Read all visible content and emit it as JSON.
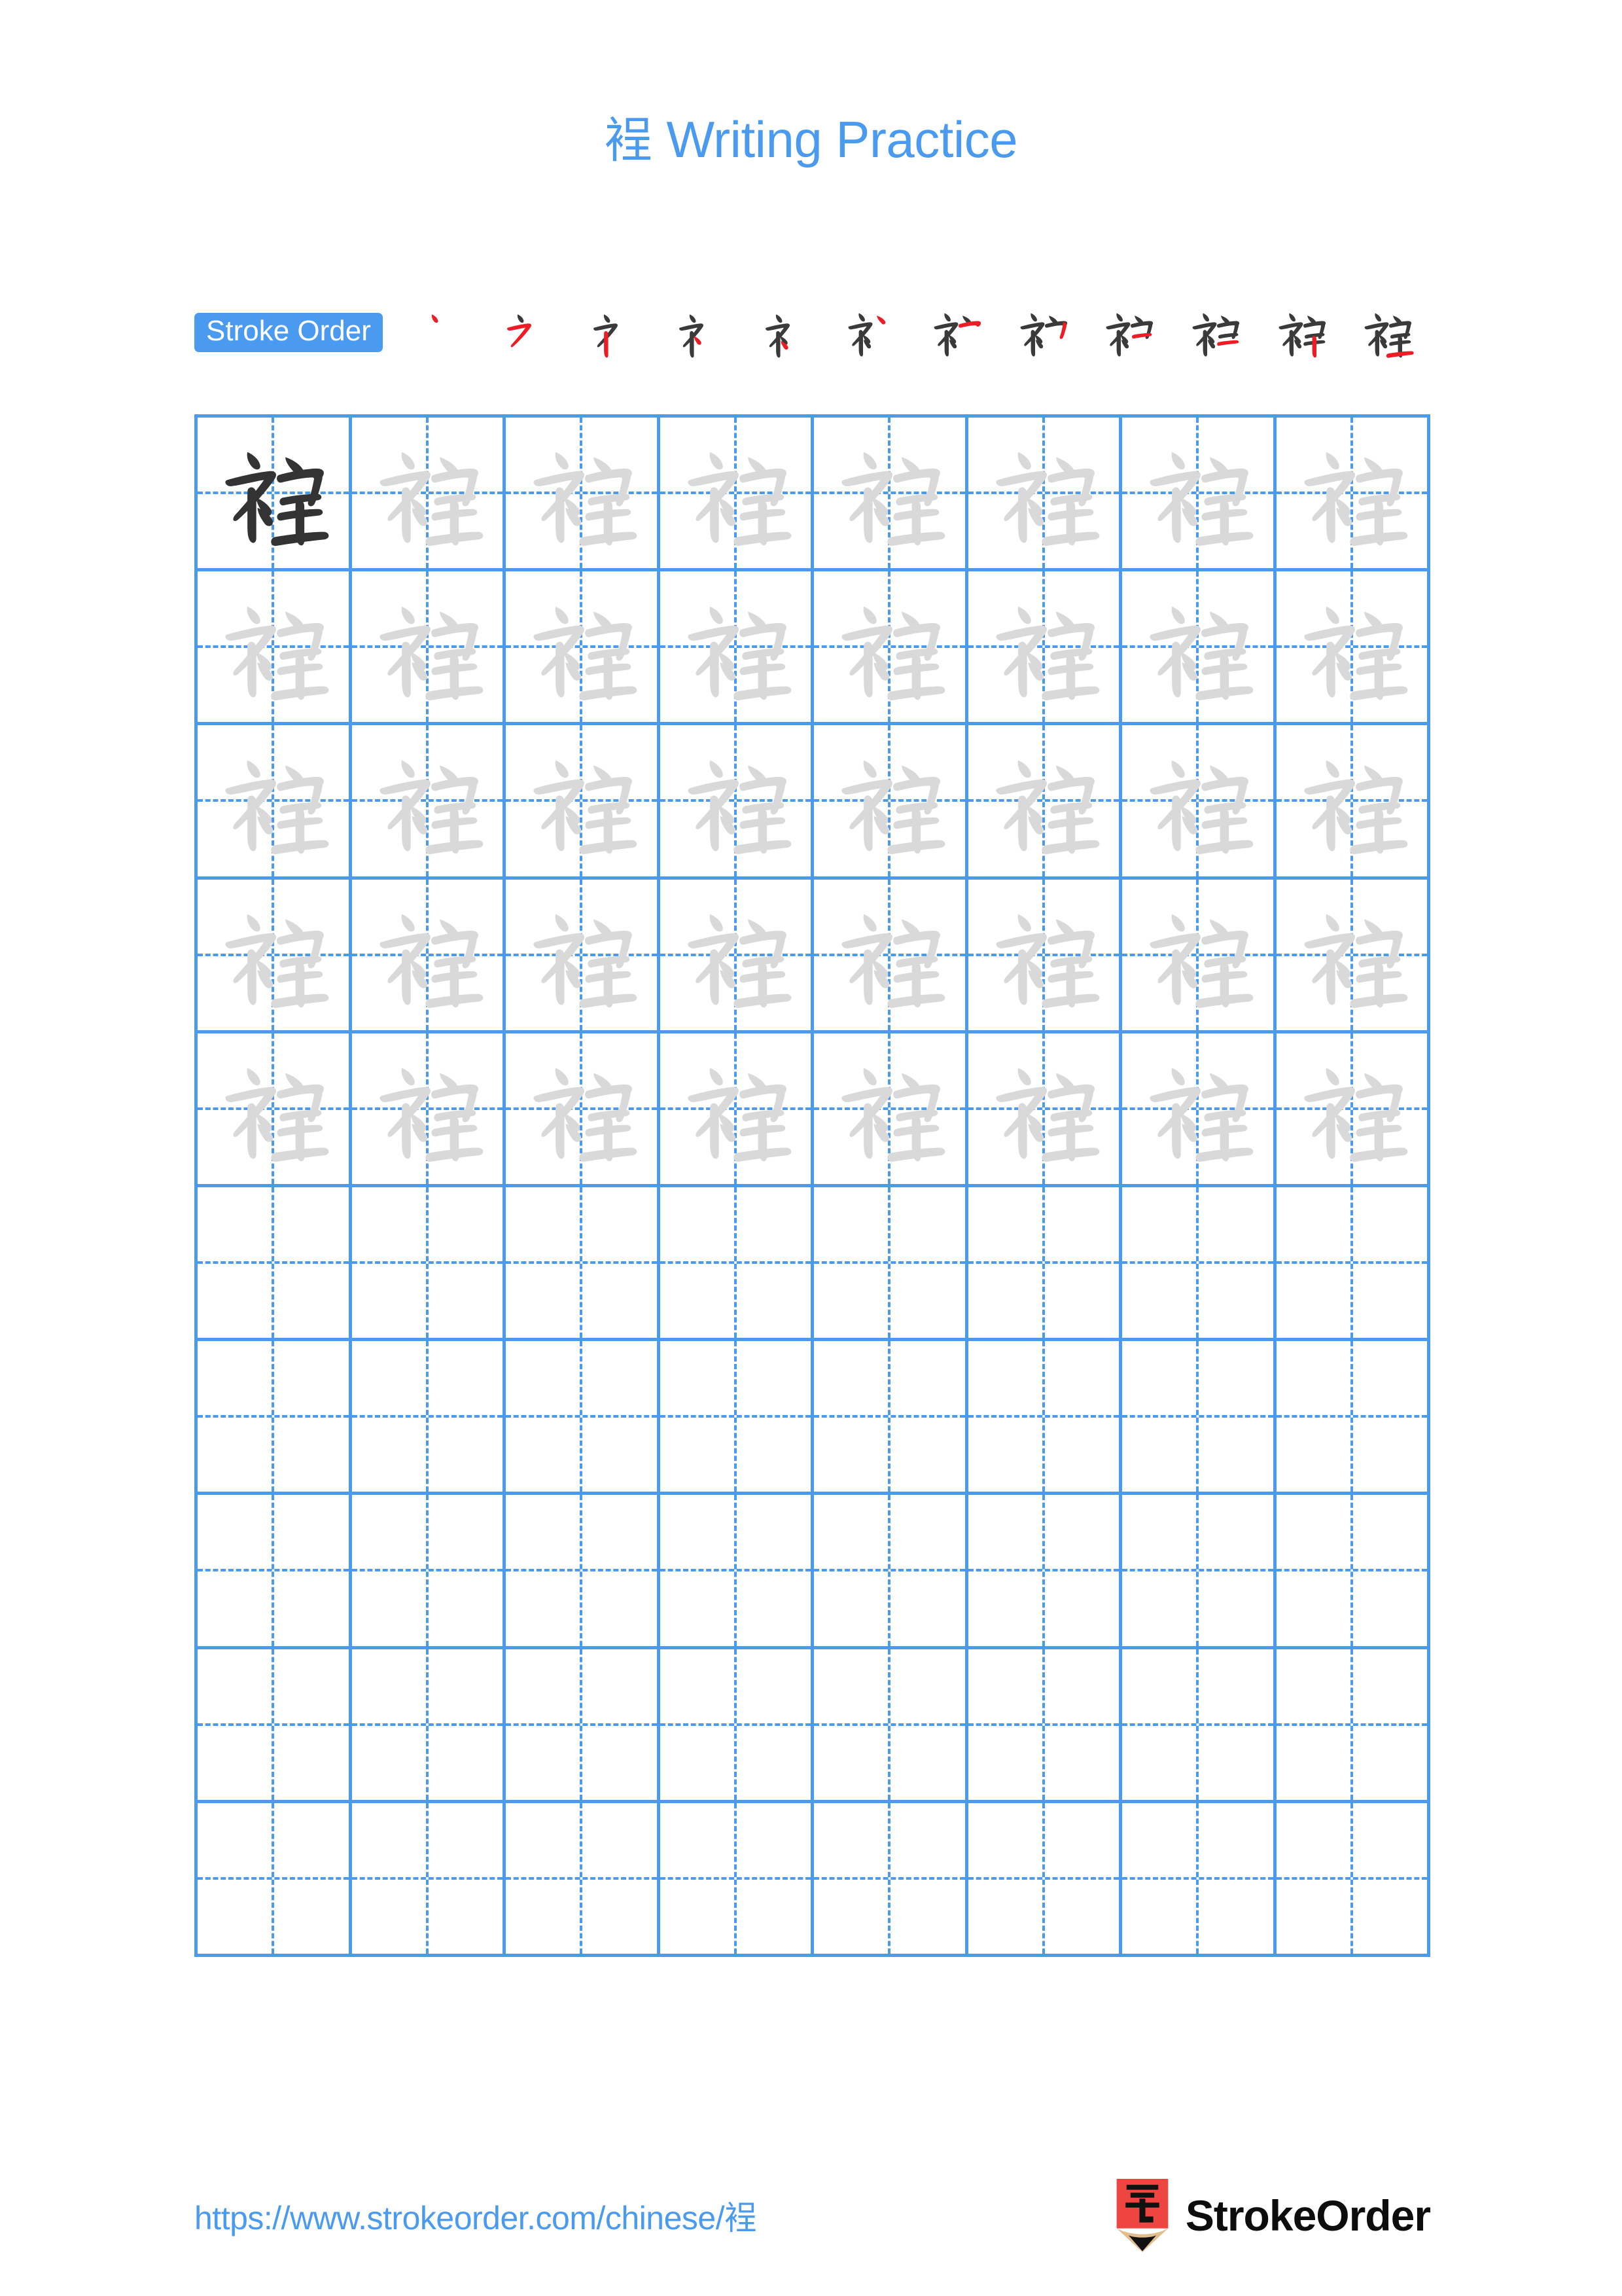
{
  "document": {
    "character": "裎",
    "title": "裎 Writing Practice",
    "title_char": "裎",
    "title_text": " Writing Practice"
  },
  "stroke_order": {
    "badge_label": "Stroke Order",
    "total_strokes": 12,
    "new_stroke_color": "#ee1c25",
    "prior_stroke_color": "#3a3a3a",
    "steps": [
      {
        "index": 1,
        "label": "stroke-1"
      },
      {
        "index": 2,
        "label": "stroke-2"
      },
      {
        "index": 3,
        "label": "stroke-3"
      },
      {
        "index": 4,
        "label": "stroke-4"
      },
      {
        "index": 5,
        "label": "stroke-5"
      },
      {
        "index": 6,
        "label": "stroke-6"
      },
      {
        "index": 7,
        "label": "stroke-7"
      },
      {
        "index": 8,
        "label": "stroke-8"
      },
      {
        "index": 9,
        "label": "stroke-9"
      },
      {
        "index": 10,
        "label": "stroke-10"
      },
      {
        "index": 11,
        "label": "stroke-11"
      },
      {
        "index": 12,
        "label": "stroke-12"
      }
    ]
  },
  "grid": {
    "columns": 8,
    "rows": 10,
    "traced_rows": 5,
    "empty_rows": 5,
    "model_cell_index": 0,
    "grid_line_color": "#4a9bf0",
    "model_glyph_color": "#333333",
    "trace_glyph_color": "#d9d9d9",
    "cell_character": "裎"
  },
  "footer": {
    "url": "https://www.strokeorder.com/chinese/裎",
    "url_prefix": "https://www.strokeorder.com/chinese/",
    "url_char": "裎",
    "brand_name": "StrokeOrder",
    "logo_char": "字",
    "logo_body_color": "#ee4540",
    "logo_wood_color": "#e3bd8e",
    "logo_tip_color": "#111111"
  }
}
